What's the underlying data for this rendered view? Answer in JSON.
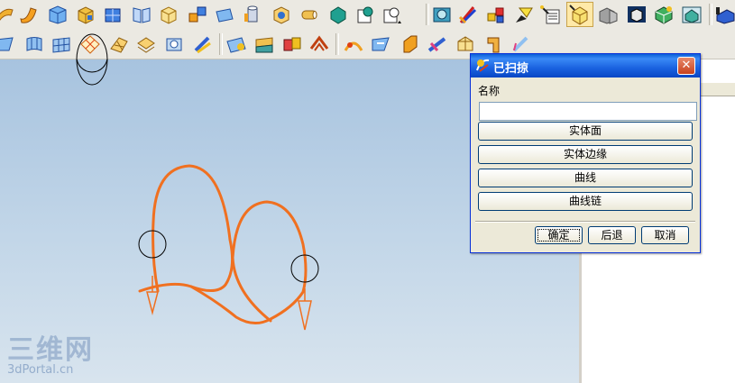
{
  "toolbar_row1": {
    "icons": [
      "revolve-icon",
      "sweep-icon",
      "surface-icon",
      "block-icon",
      "box-icon",
      "book-icon",
      "cube-icon",
      "pattern-icon",
      "face-icon",
      "cylinder-icon",
      "part-icon",
      "tube-icon",
      "sphere-icon",
      "node-icon",
      "sketch-icon",
      "render-icon",
      "brush-icon",
      "assembly-icon",
      "light-icon",
      "layout-icon",
      "highlight-icon",
      "shade-icon",
      "wire-icon",
      "grid-icon",
      "view-icon",
      "orient-icon"
    ]
  },
  "toolbar_row2": {
    "icons": [
      "ruled-icon",
      "through-curves-icon",
      "mesh-icon",
      "swept-icon",
      "n-sided-icon",
      "extension-icon",
      "law-icon",
      "offset-icon",
      "trim-icon",
      "flange-icon",
      "fold-icon",
      "cap-icon",
      "bridge-icon",
      "blend-icon",
      "chamfer-icon",
      "fillet-icon",
      "section-icon",
      "profile-icon",
      "thicken-icon"
    ]
  },
  "dialog": {
    "title": "已扫掠",
    "name_label": "名称",
    "name_value": "",
    "selection_buttons": [
      "实体面",
      "实体边缘",
      "曲线",
      "曲线链"
    ],
    "ok": "确定",
    "back": "后退",
    "cancel": "取消"
  },
  "watermark": {
    "line1": "三维网",
    "line2": "3dPortal.cn"
  },
  "colors": {
    "curve": "#f07020",
    "titlebar": "#0a5fd8",
    "dialog_bg": "#ece9d8"
  }
}
